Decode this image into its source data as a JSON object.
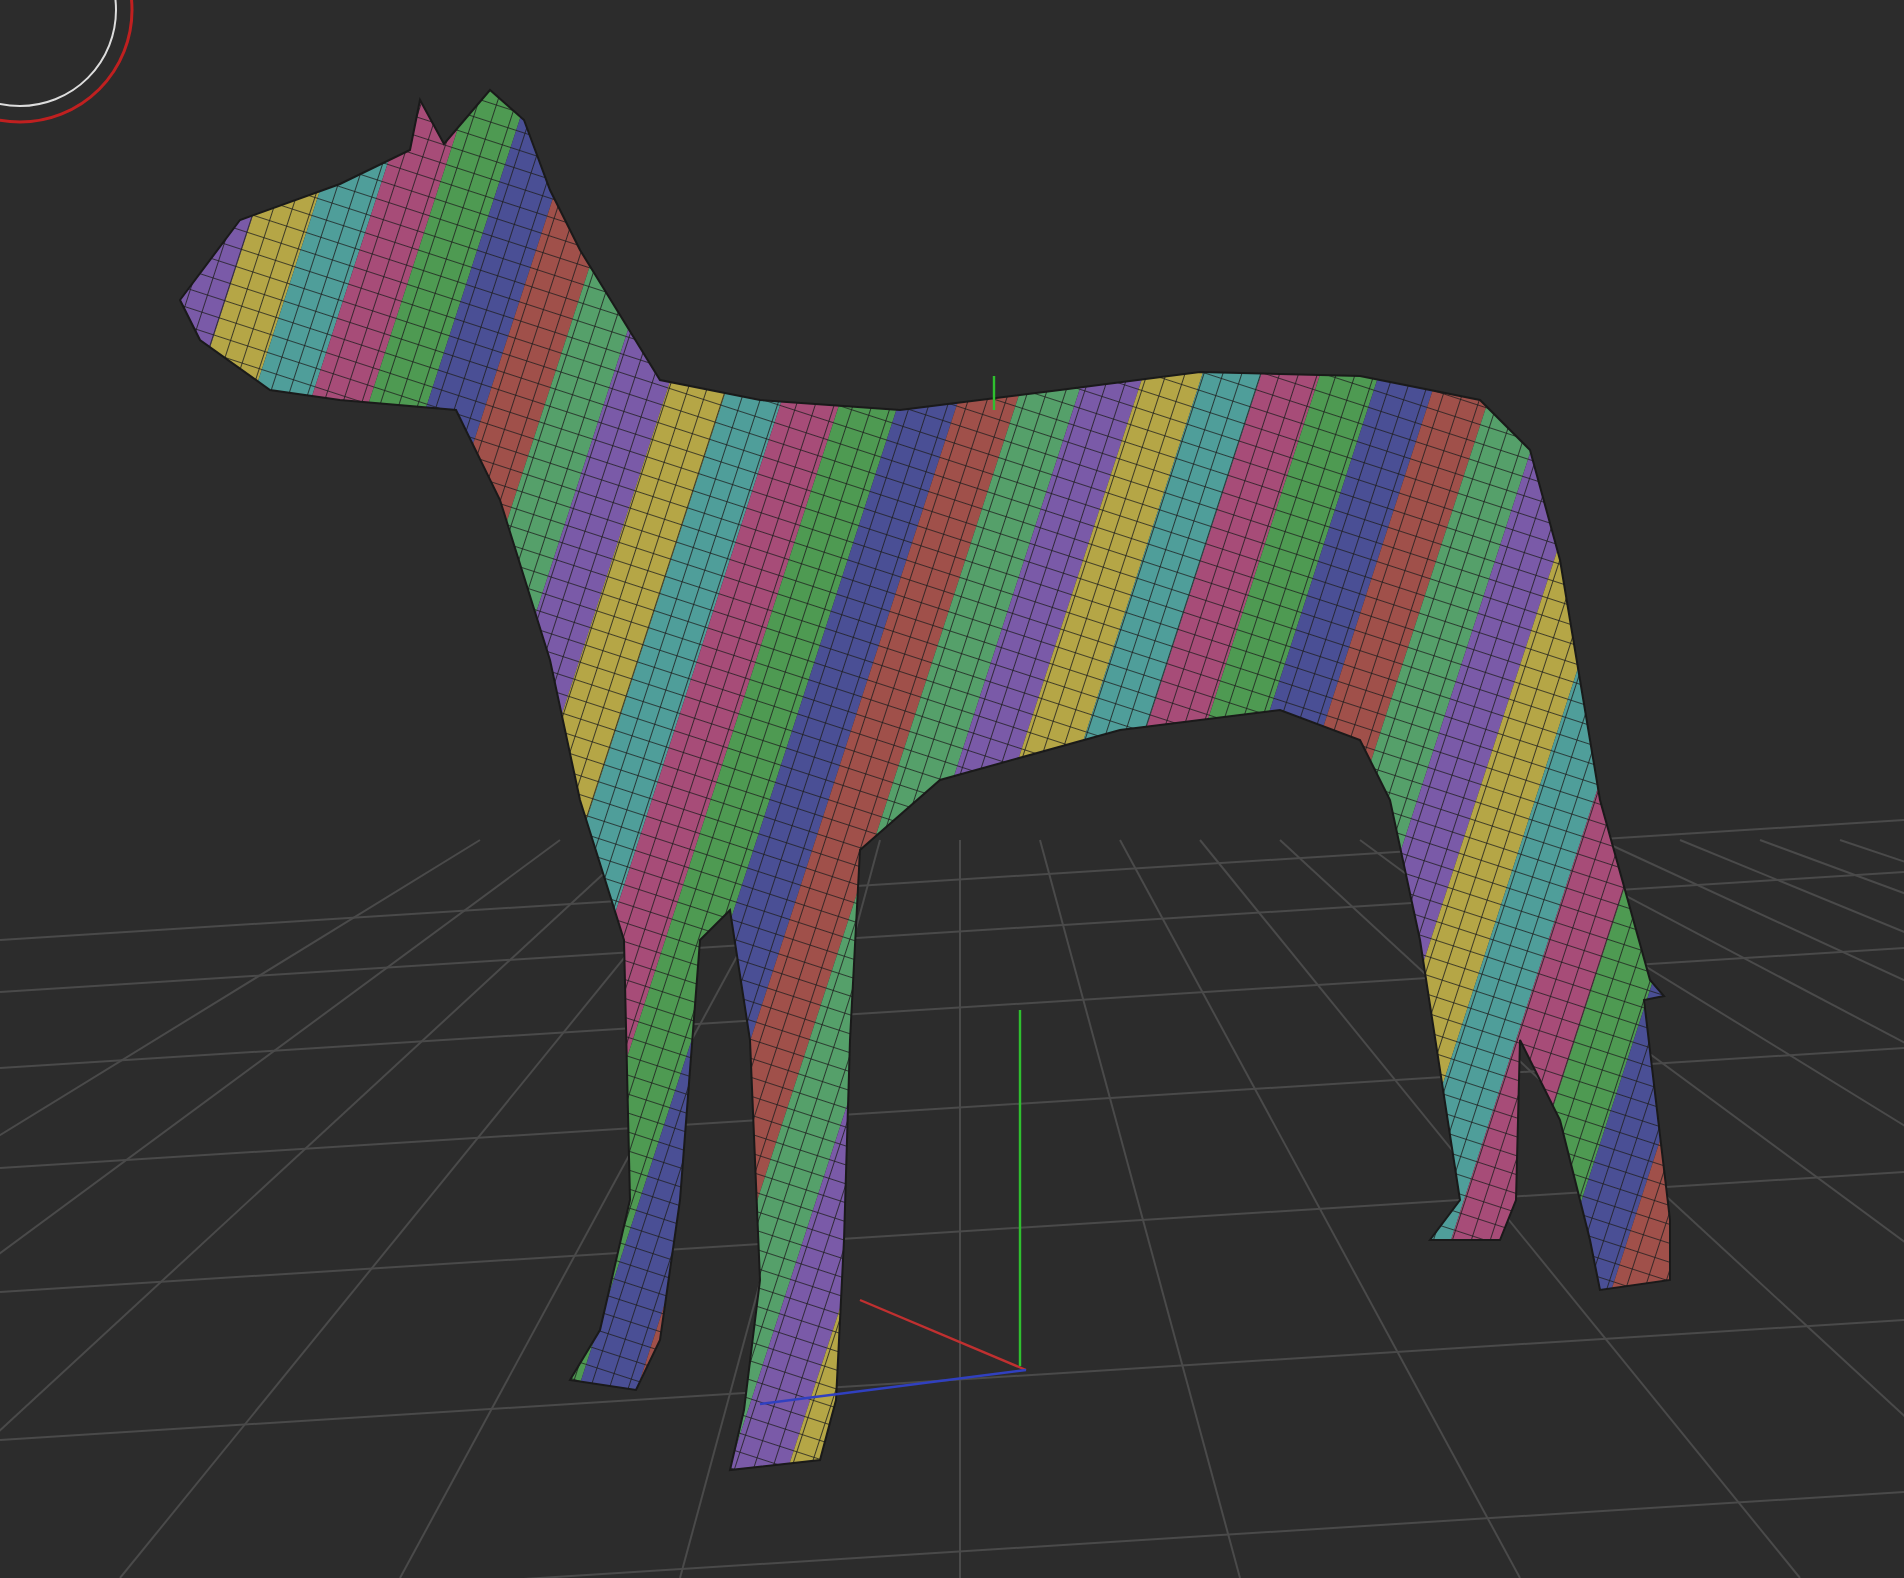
{
  "viewport": {
    "grid_visible": true,
    "axes_visible": true,
    "gizmo_visible": true
  }
}
